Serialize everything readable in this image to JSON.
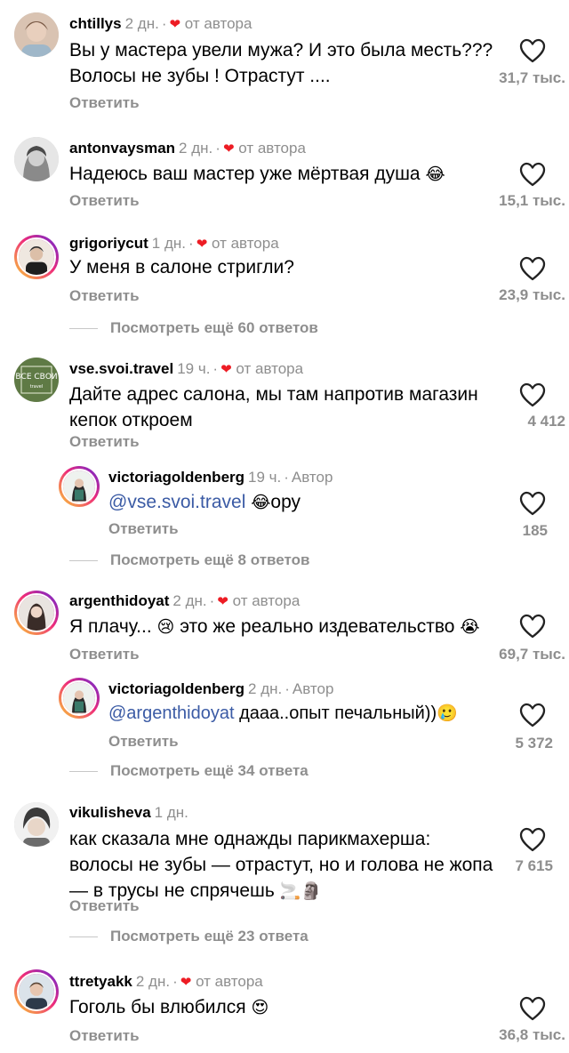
{
  "comments": [
    {
      "user": "chtillys",
      "time": "2 дн.",
      "by_author": "от автора",
      "text_line1": "Вы у мастера увели мужа? И это была месть???",
      "text_line2": "Волосы не зубы ! Отрастут ....",
      "reply": "Ответить",
      "likes": "31,7 тыс."
    },
    {
      "user": "antonvaysman",
      "time": "2 дн.",
      "by_author": "от автора",
      "text_line1": "Надеюсь ваш мастер уже мёртвая душа",
      "emoji": "😂",
      "reply": "Ответить",
      "likes": "15,1 тыс."
    },
    {
      "user": "grigoriycut",
      "time": "1 дн.",
      "by_author": "от автора",
      "text_line1": "У меня в салоне стригли?",
      "reply": "Ответить",
      "likes": "23,9 тыс.",
      "more_replies": "Посмотреть ещё 60 ответов"
    },
    {
      "user": "vse.svoi.travel",
      "time": "19 ч.",
      "by_author": "от автора",
      "avatar_text": "ВСЕ СВОИ",
      "text_line1": "Дайте адрес салона, мы там напротив магазин",
      "text_line2": "кепок откроем",
      "reply": "Ответить",
      "likes": "4 412",
      "sub": {
        "user": "victoriagoldenberg",
        "time": "19 ч.",
        "author_tag": "Автор",
        "mention": "@vse.svoi.travel",
        "emoji": "😂",
        "text": "ору",
        "reply": "Ответить",
        "likes": "185"
      },
      "more_replies": "Посмотреть ещё 8 ответов"
    },
    {
      "user": "argenthidoyat",
      "time": "2 дн.",
      "by_author": "от автора",
      "text_a": "Я плачу...",
      "emoji_a": "😢",
      "text_b": "это же реально издевательство",
      "emoji_b": "😭",
      "reply": "Ответить",
      "likes": "69,7 тыс.",
      "sub": {
        "user": "victoriagoldenberg",
        "time": "2 дн.",
        "author_tag": "Автор",
        "mention": "@argenthidoyat",
        "text": "дааа..опыт печальный))",
        "emoji": "🥲",
        "reply": "Ответить",
        "likes": "5 372"
      },
      "more_replies": "Посмотреть ещё 34 ответа"
    },
    {
      "user": "vikulisheva",
      "time": "1 дн.",
      "text_line1": "как сказала мне однажды парикмахерша:",
      "text_line2": "волосы не зубы — отрастут, но и голова не жопа",
      "text_line3": "— в трусы не спрячешь",
      "emoji": "🚬🗿",
      "reply": "Ответить",
      "likes": "7 615",
      "more_replies": "Посмотреть ещё 23 ответа"
    },
    {
      "user": "ttretyakk",
      "time": "2 дн.",
      "by_author": "от автора",
      "text_line1": "Гоголь бы влюбился",
      "emoji": "😍",
      "reply": "Ответить",
      "likes": "36,8 тыс."
    }
  ],
  "colors": {
    "accent_heart": "#ed1c24",
    "secondary_text": "#8e8e8e",
    "mention": "#3b5ba5"
  },
  "icons": {
    "like": "heart-outline-icon",
    "liked_by_author": "heart-filled-icon"
  }
}
